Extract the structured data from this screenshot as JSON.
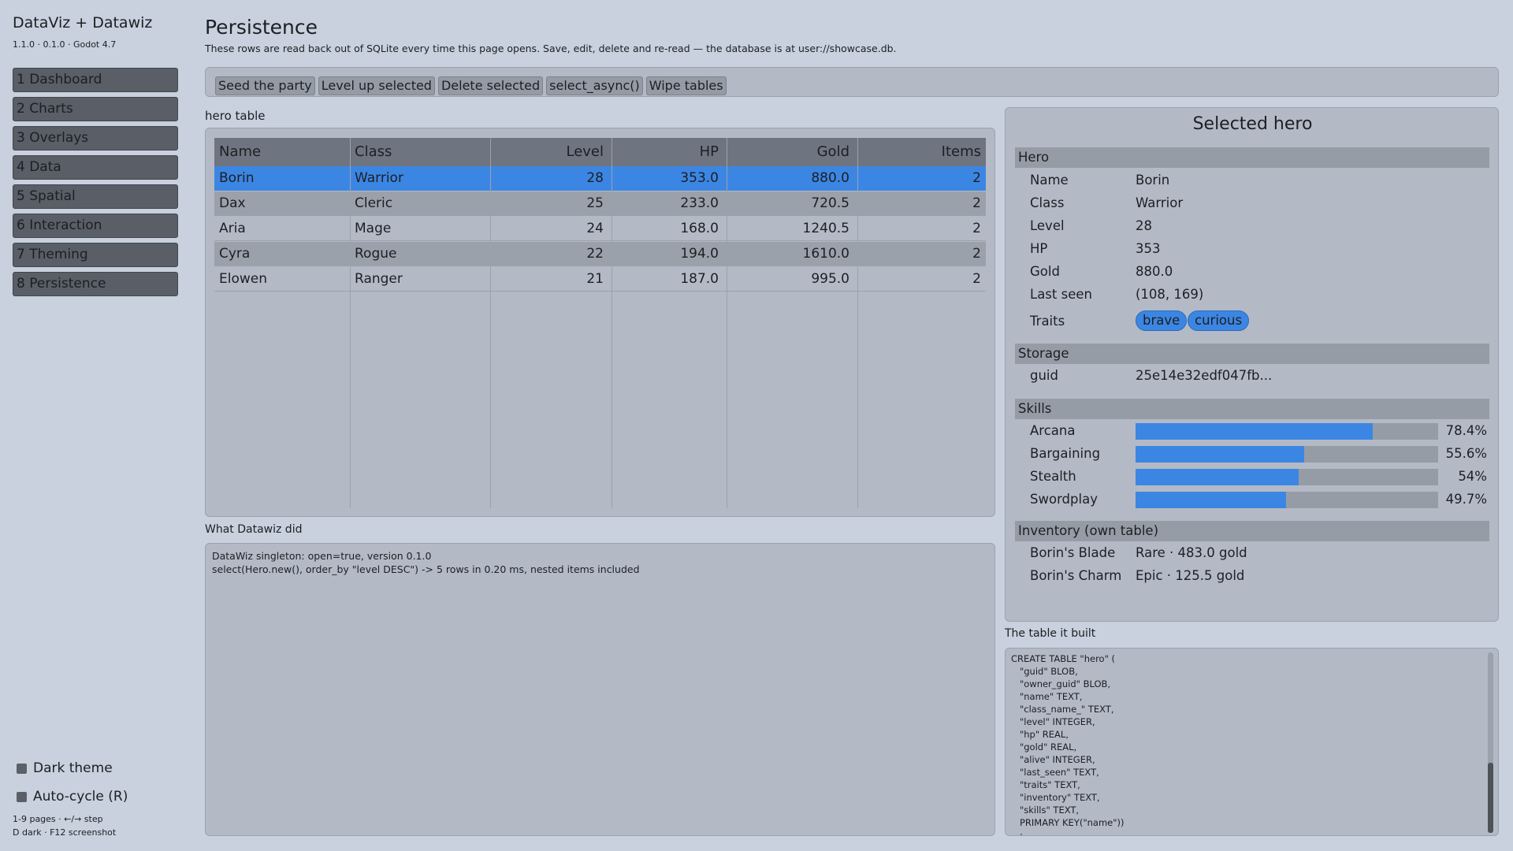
{
  "app": {
    "title": "DataViz + Datawiz",
    "version": "1.1.0 · 0.1.0 · Godot 4.7"
  },
  "nav": [
    {
      "label": "1  Dashboard"
    },
    {
      "label": "2  Charts"
    },
    {
      "label": "3  Overlays"
    },
    {
      "label": "4  Data"
    },
    {
      "label": "5  Spatial"
    },
    {
      "label": "6  Interaction"
    },
    {
      "label": "7  Theming"
    },
    {
      "label": "8  Persistence"
    }
  ],
  "toggles": {
    "dark_theme": "Dark theme",
    "auto_cycle": "Auto-cycle (R)"
  },
  "hints": {
    "line1": "1-9 pages · ←/→ step",
    "line2": "D dark · F12 screenshot"
  },
  "page": {
    "title": "Persistence",
    "subtitle": "These rows are read back out of SQLite every time this page opens. Save, edit, delete and re-read — the database is at user://showcase.db."
  },
  "toolbar": {
    "seed": "Seed the party",
    "level_up": "Level up selected",
    "delete": "Delete selected",
    "select_async": "select_async()",
    "wipe": "Wipe tables"
  },
  "table": {
    "label": "hero table",
    "columns": [
      "Name",
      "Class",
      "Level",
      "HP",
      "Gold",
      "Items"
    ],
    "rows": [
      [
        "Borin",
        "Warrior",
        "28",
        "353.0",
        "880.0",
        "2"
      ],
      [
        "Dax",
        "Cleric",
        "25",
        "233.0",
        "720.5",
        "2"
      ],
      [
        "Aria",
        "Mage",
        "24",
        "168.0",
        "1240.5",
        "2"
      ],
      [
        "Cyra",
        "Rogue",
        "22",
        "194.0",
        "1610.0",
        "2"
      ],
      [
        "Elowen",
        "Ranger",
        "21",
        "187.0",
        "995.0",
        "2"
      ]
    ],
    "selected_index": 0
  },
  "log": {
    "label": "What Datawiz did",
    "lines": [
      "DataWiz singleton: open=true, version 0.1.0",
      "select(Hero.new(), order_by \"level DESC\") -> 5 rows in 0.20 ms, nested items included"
    ]
  },
  "hero": {
    "title": "Selected hero",
    "group_hero": "Hero",
    "fields": [
      {
        "key": "Name",
        "value": "Borin"
      },
      {
        "key": "Class",
        "value": "Warrior"
      },
      {
        "key": "Level",
        "value": "28"
      },
      {
        "key": "HP",
        "value": "353"
      },
      {
        "key": "Gold",
        "value": "880.0"
      },
      {
        "key": "Last seen",
        "value": "(108, 169)"
      }
    ],
    "traits_label": "Traits",
    "traits": [
      "brave",
      "curious"
    ],
    "group_storage": "Storage",
    "guid_label": "guid",
    "guid_value": "25e14e32edf047fb...",
    "group_skills": "Skills",
    "skills": [
      {
        "name": "Arcana",
        "value": 0.784,
        "label": "78.4%"
      },
      {
        "name": "Bargaining",
        "value": 0.556,
        "label": "55.6%"
      },
      {
        "name": "Stealth",
        "value": 0.54,
        "label": "54%"
      },
      {
        "name": "Swordplay",
        "value": 0.497,
        "label": "49.7%"
      }
    ],
    "group_inventory": "Inventory (own table)",
    "inventory": [
      {
        "name": "Borin's Blade",
        "value": "Rare · 483.0 gold"
      },
      {
        "name": "Borin's Charm",
        "value": "Epic · 125.5 gold"
      }
    ]
  },
  "sql": {
    "label": "The table it built",
    "text": "CREATE TABLE \"hero\" (\n   \"guid\" BLOB,\n   \"owner_guid\" BLOB,\n   \"name\" TEXT,\n   \"class_name_\" TEXT,\n   \"level\" INTEGER,\n   \"hp\" REAL,\n   \"gold\" REAL,\n   \"alive\" INTEGER,\n   \"last_seen\" TEXT,\n   \"traits\" TEXT,\n   \"inventory\" TEXT,\n   \"skills\" TEXT,\n   PRIMARY KEY(\"name\"))\n   ;"
  },
  "colors": {
    "accent": "#3c86e3",
    "background": "#c8d1dd",
    "panel": "#b3bac6",
    "selected_row": "#3c86e3"
  }
}
